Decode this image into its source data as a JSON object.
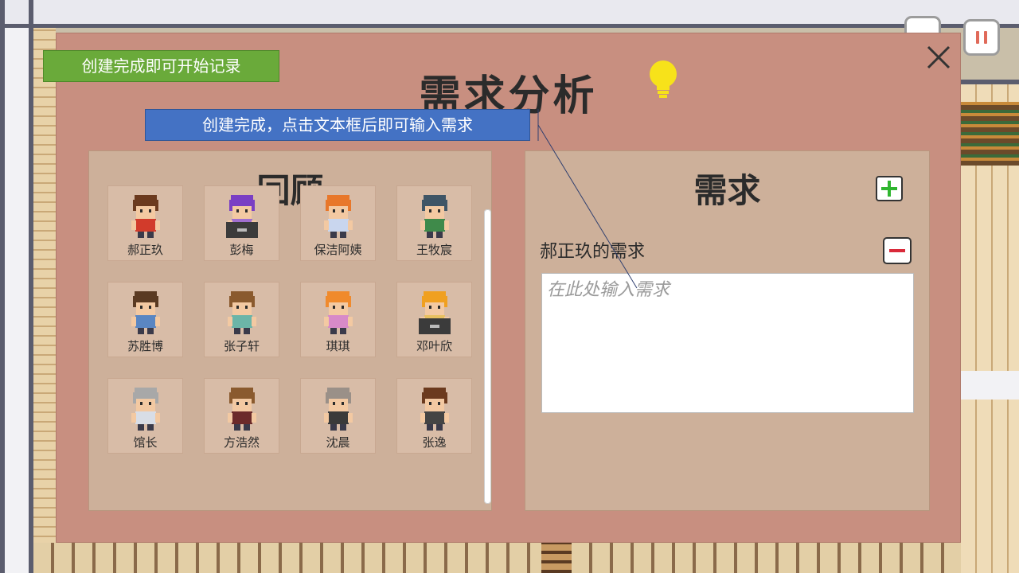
{
  "panel": {
    "title": "需求分析",
    "close_icon": "close-icon",
    "bulb_icon": "lightbulb-icon"
  },
  "hints": {
    "green": "创建完成即可开始记录",
    "blue": "创建完成，点击文本框后即可输入需求"
  },
  "review": {
    "title": "回顾",
    "characters": [
      {
        "name": "郝正玖",
        "hair": "#6b3a1e",
        "shirt": "#d23b2b",
        "laptop": false
      },
      {
        "name": "彭梅",
        "hair": "#7a3fc4",
        "shirt": "#a06fd0",
        "laptop": true
      },
      {
        "name": "保洁阿姨",
        "hair": "#e8772a",
        "shirt": "#c9d6ee",
        "laptop": false
      },
      {
        "name": "王牧宸",
        "hair": "#3f5566",
        "shirt": "#3f8a4a",
        "laptop": false
      },
      {
        "name": "苏胜博",
        "hair": "#5a3a22",
        "shirt": "#5a86c2",
        "laptop": false
      },
      {
        "name": "张子轩",
        "hair": "#8a5a2e",
        "shirt": "#6cb5a8",
        "laptop": false
      },
      {
        "name": "琪琪",
        "hair": "#f08a2c",
        "shirt": "#d88ac8",
        "laptop": false
      },
      {
        "name": "邓叶欣",
        "hair": "#f0a020",
        "shirt": "#e8c060",
        "laptop": true
      },
      {
        "name": "馆长",
        "hair": "#a8a8a8",
        "shirt": "#d8dde6",
        "laptop": false
      },
      {
        "name": "方浩然",
        "hair": "#8a5a2e",
        "shirt": "#6b2a2a",
        "laptop": false
      },
      {
        "name": "沈晨",
        "hair": "#9a9088",
        "shirt": "#3a3a3a",
        "laptop": false
      },
      {
        "name": "张逸",
        "hair": "#6b3a1e",
        "shirt": "#444444",
        "laptop": false
      }
    ]
  },
  "requirement": {
    "title": "需求",
    "add_icon": "plus-icon",
    "remove_icon": "minus-icon",
    "entries": [
      {
        "label": "郝正玖的需求",
        "placeholder": "在此处输入需求",
        "value": ""
      }
    ]
  },
  "hud": {
    "pause_icon": "pause-icon"
  },
  "colors": {
    "panel": "#c88f80",
    "section": "#cdb09a",
    "hint_green": "#6aaa3a",
    "hint_blue": "#4472c4",
    "add_green": "#2fb52f",
    "remove_red": "#d92a3a"
  }
}
